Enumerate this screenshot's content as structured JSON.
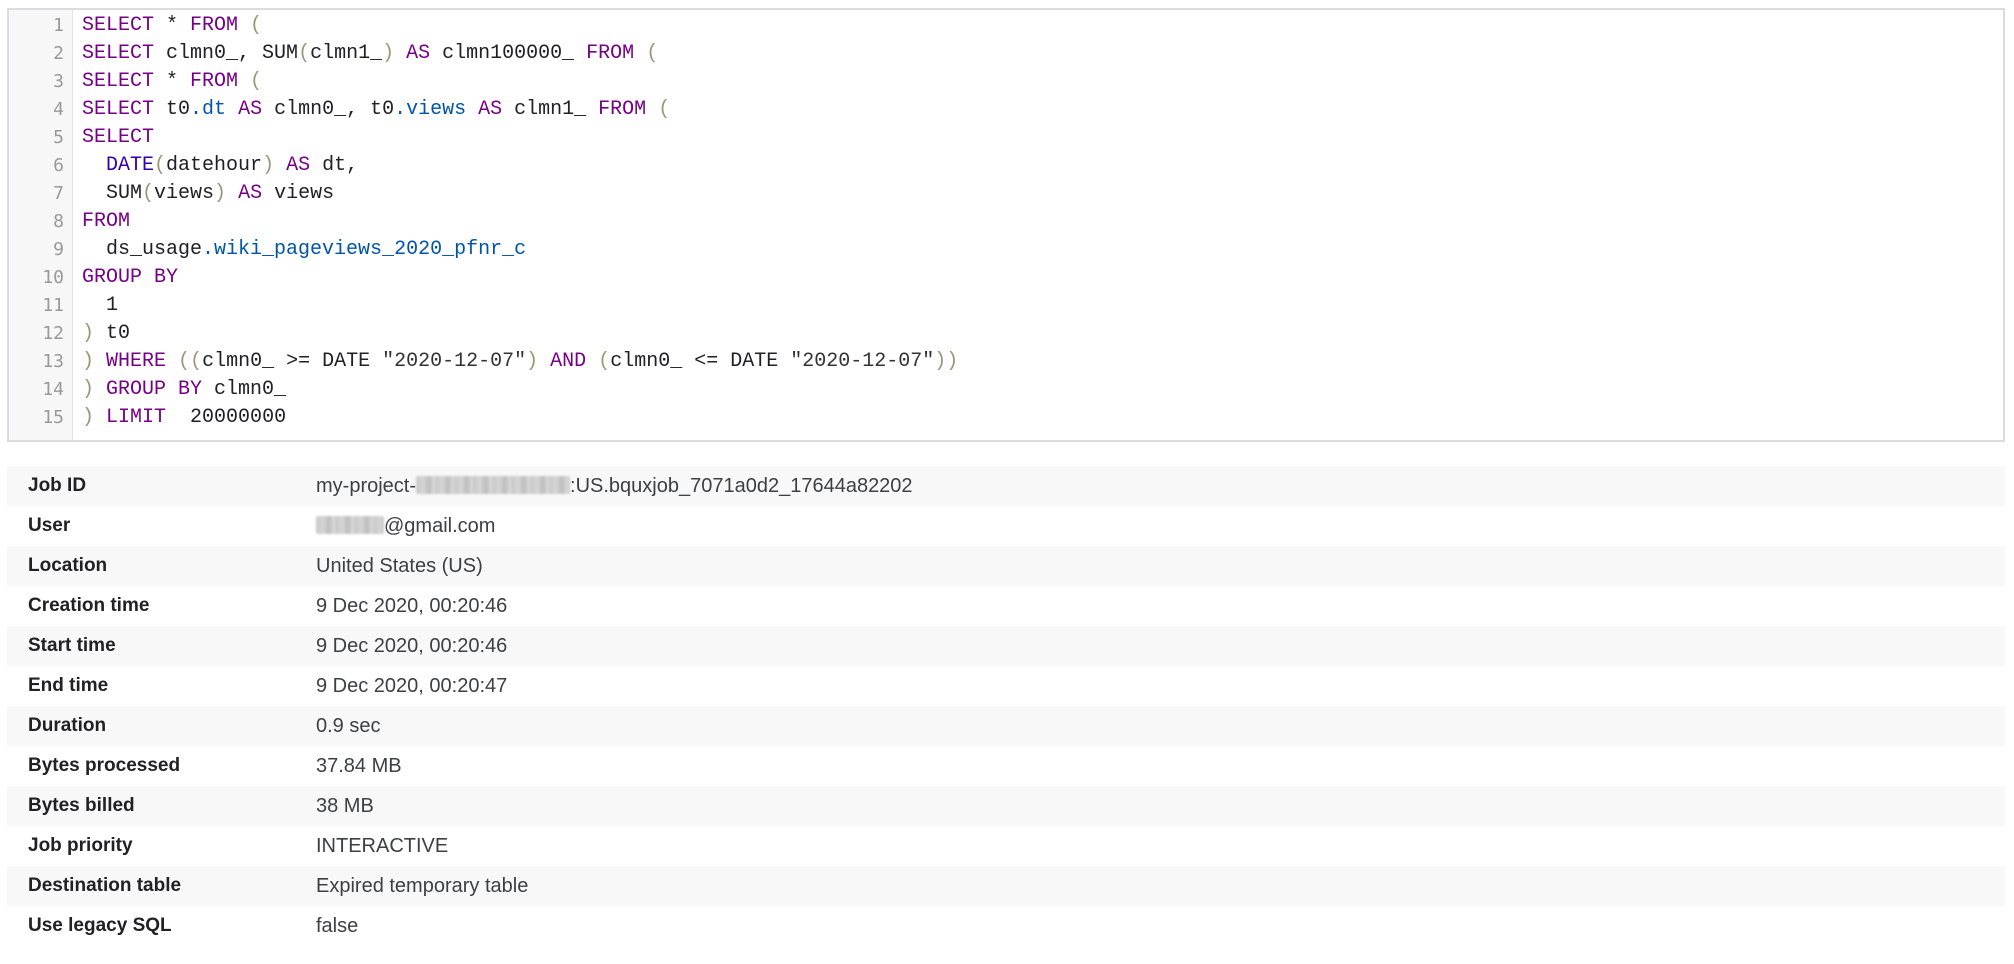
{
  "query": {
    "lines": [
      {
        "num": "1",
        "tokens": [
          {
            "t": "SELECT",
            "c": "kw"
          },
          {
            "t": " * ",
            "c": "nm"
          },
          {
            "t": "FROM",
            "c": "kw"
          },
          {
            "t": " (",
            "c": "pn"
          }
        ]
      },
      {
        "num": "2",
        "tokens": [
          {
            "t": "SELECT",
            "c": "kw"
          },
          {
            "t": " clmn0_, ",
            "c": "nm"
          },
          {
            "t": "SUM",
            "c": "nm"
          },
          {
            "t": "(",
            "c": "pn"
          },
          {
            "t": "clmn1_",
            "c": "nm"
          },
          {
            "t": ")",
            "c": "pn"
          },
          {
            "t": " ",
            "c": "nm"
          },
          {
            "t": "AS",
            "c": "kw"
          },
          {
            "t": " clmn100000_ ",
            "c": "nm"
          },
          {
            "t": "FROM",
            "c": "kw"
          },
          {
            "t": " (",
            "c": "pn"
          }
        ]
      },
      {
        "num": "3",
        "tokens": [
          {
            "t": "SELECT",
            "c": "kw"
          },
          {
            "t": " * ",
            "c": "nm"
          },
          {
            "t": "FROM",
            "c": "kw"
          },
          {
            "t": " (",
            "c": "pn"
          }
        ]
      },
      {
        "num": "4",
        "tokens": [
          {
            "t": "SELECT",
            "c": "kw"
          },
          {
            "t": " t0",
            "c": "nm"
          },
          {
            "t": ".dt",
            "c": "vr"
          },
          {
            "t": " ",
            "c": "nm"
          },
          {
            "t": "AS",
            "c": "kw"
          },
          {
            "t": " clmn0_, t0",
            "c": "nm"
          },
          {
            "t": ".views",
            "c": "vr"
          },
          {
            "t": " ",
            "c": "nm"
          },
          {
            "t": "AS",
            "c": "kw"
          },
          {
            "t": " clmn1_ ",
            "c": "nm"
          },
          {
            "t": "FROM",
            "c": "kw"
          },
          {
            "t": " (",
            "c": "pn"
          }
        ]
      },
      {
        "num": "5",
        "tokens": [
          {
            "t": "SELECT",
            "c": "kw"
          }
        ]
      },
      {
        "num": "6",
        "tokens": [
          {
            "t": "  ",
            "c": "nm"
          },
          {
            "t": "DATE",
            "c": "fn"
          },
          {
            "t": "(",
            "c": "pn"
          },
          {
            "t": "datehour",
            "c": "nm"
          },
          {
            "t": ")",
            "c": "pn"
          },
          {
            "t": " ",
            "c": "nm"
          },
          {
            "t": "AS",
            "c": "kw"
          },
          {
            "t": " dt,",
            "c": "nm"
          }
        ]
      },
      {
        "num": "7",
        "tokens": [
          {
            "t": "  SUM",
            "c": "nm"
          },
          {
            "t": "(",
            "c": "pn"
          },
          {
            "t": "views",
            "c": "nm"
          },
          {
            "t": ")",
            "c": "pn"
          },
          {
            "t": " ",
            "c": "nm"
          },
          {
            "t": "AS",
            "c": "kw"
          },
          {
            "t": " views",
            "c": "nm"
          }
        ]
      },
      {
        "num": "8",
        "tokens": [
          {
            "t": "FROM",
            "c": "kw"
          }
        ]
      },
      {
        "num": "9",
        "tokens": [
          {
            "t": "  ds_usage",
            "c": "nm"
          },
          {
            "t": ".wiki_pageviews_2020_pfnr_c",
            "c": "vr"
          }
        ]
      },
      {
        "num": "10",
        "tokens": [
          {
            "t": "GROUP BY",
            "c": "kw"
          }
        ]
      },
      {
        "num": "11",
        "tokens": [
          {
            "t": "  1",
            "c": "nm"
          }
        ]
      },
      {
        "num": "12",
        "tokens": [
          {
            "t": ")",
            "c": "pn"
          },
          {
            "t": " t0",
            "c": "nm"
          }
        ]
      },
      {
        "num": "13",
        "tokens": [
          {
            "t": ")",
            "c": "pn"
          },
          {
            "t": " ",
            "c": "nm"
          },
          {
            "t": "WHERE",
            "c": "kw"
          },
          {
            "t": " ((",
            "c": "pn"
          },
          {
            "t": "clmn0_ >= DATE ",
            "c": "nm"
          },
          {
            "t": "\"2020-12-07\"",
            "c": "st"
          },
          {
            "t": ")",
            "c": "pn"
          },
          {
            "t": " ",
            "c": "nm"
          },
          {
            "t": "AND",
            "c": "kw"
          },
          {
            "t": " (",
            "c": "pn"
          },
          {
            "t": "clmn0_ <= DATE ",
            "c": "nm"
          },
          {
            "t": "\"2020-12-07\"",
            "c": "st"
          },
          {
            "t": "))",
            "c": "pn"
          }
        ]
      },
      {
        "num": "14",
        "tokens": [
          {
            "t": ")",
            "c": "pn"
          },
          {
            "t": " ",
            "c": "nm"
          },
          {
            "t": "GROUP BY",
            "c": "kw"
          },
          {
            "t": " clmn0_",
            "c": "nm"
          }
        ]
      },
      {
        "num": "15",
        "tokens": [
          {
            "t": ")",
            "c": "pn"
          },
          {
            "t": " ",
            "c": "nm"
          },
          {
            "t": "LIMIT",
            "c": "kw"
          },
          {
            "t": "  20000000",
            "c": "nm"
          }
        ]
      }
    ]
  },
  "job_info": {
    "job_id": {
      "label": "Job ID",
      "prefix": "my-project-",
      "suffix": ":US.bquxjob_7071a0d2_17644a82202"
    },
    "user": {
      "label": "User",
      "suffix": "@gmail.com"
    },
    "location": {
      "label": "Location",
      "value": "United States (US)"
    },
    "creation_time": {
      "label": "Creation time",
      "value": "9 Dec 2020, 00:20:46"
    },
    "start_time": {
      "label": "Start time",
      "value": "9 Dec 2020, 00:20:46"
    },
    "end_time": {
      "label": "End time",
      "value": "9 Dec 2020, 00:20:47"
    },
    "duration": {
      "label": "Duration",
      "value": "0.9 sec"
    },
    "bytes_processed": {
      "label": "Bytes processed",
      "value": "37.84 MB"
    },
    "bytes_billed": {
      "label": "Bytes billed",
      "value": "38 MB"
    },
    "job_priority": {
      "label": "Job priority",
      "value": "INTERACTIVE"
    },
    "destination_table": {
      "label": "Destination table",
      "value": "Expired temporary table"
    },
    "use_legacy_sql": {
      "label": "Use legacy SQL",
      "value": "false"
    }
  }
}
